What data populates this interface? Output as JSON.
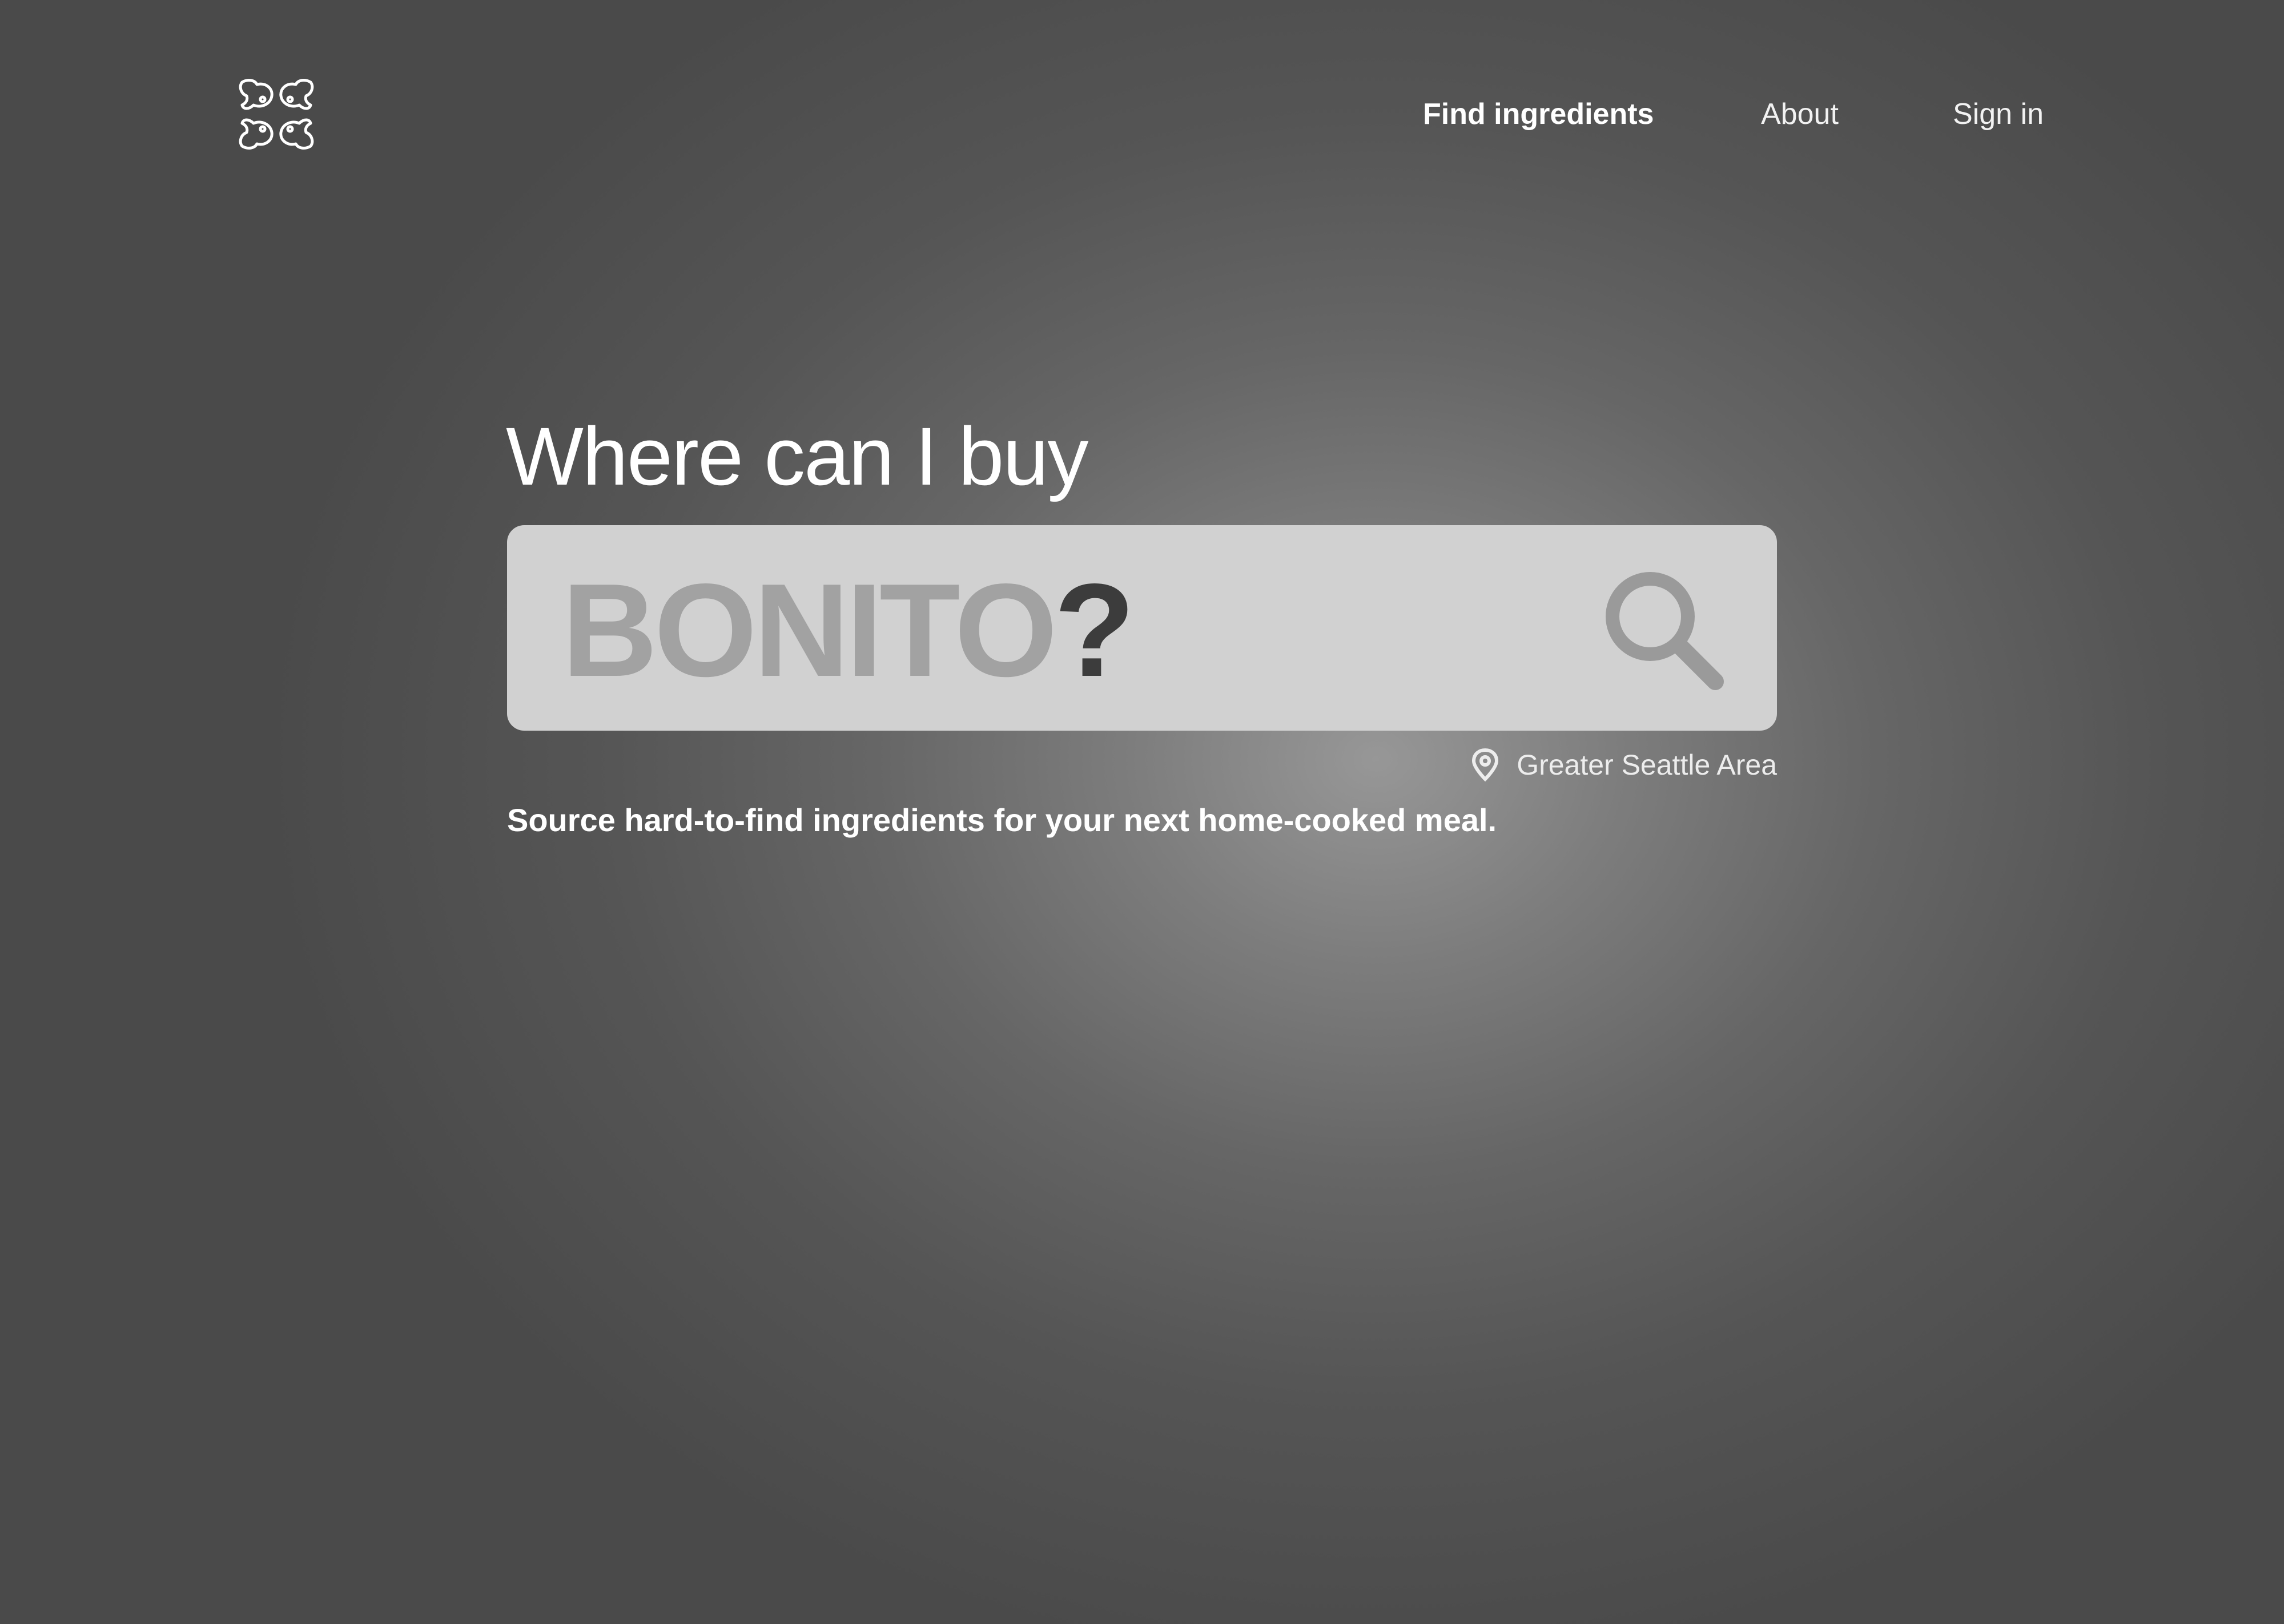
{
  "nav": {
    "items": [
      {
        "label": "Find ingredients",
        "active": true
      },
      {
        "label": "About",
        "active": false
      },
      {
        "label": "Sign in",
        "active": false
      }
    ]
  },
  "hero": {
    "heading": "Where can I buy",
    "search_value": "BONITO",
    "search_suffix": "?",
    "location": "Greater Seattle Area",
    "tagline": "Source hard-to-find ingredients for your next home-cooked meal."
  },
  "icons": {
    "logo": "fish-logo-icon",
    "search": "search-icon",
    "location": "map-pin-icon"
  },
  "colors": {
    "search_box": "#d1d1d1",
    "search_value": "#a2a2a2",
    "search_suffix": "#3c3c3c",
    "search_icon": "#9a9a9a",
    "text": "#ffffff"
  }
}
